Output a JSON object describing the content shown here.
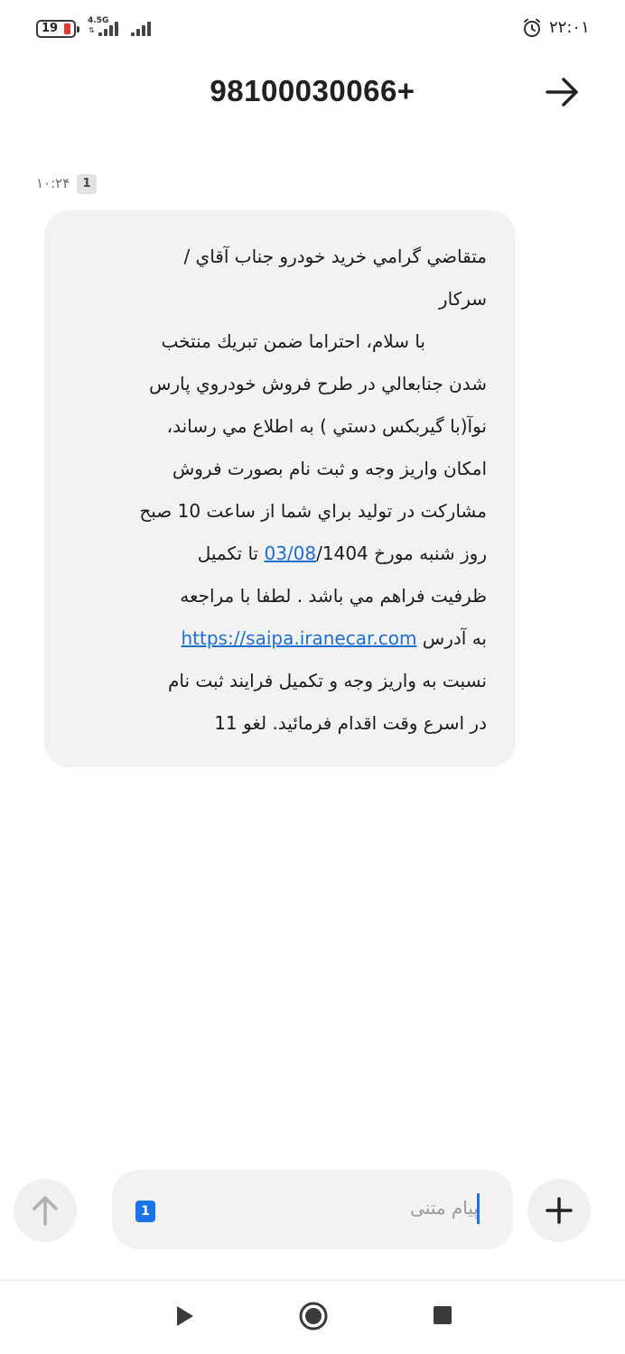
{
  "status_bar": {
    "battery_level": "19",
    "network_type": "4.5G",
    "clock": "۲۲:۰۱",
    "icons": [
      "battery-icon",
      "signal-icon",
      "signal-icon",
      "alarm-icon"
    ]
  },
  "header": {
    "title": "98100030066+",
    "back_icon": "arrow-right-icon"
  },
  "message": {
    "time": "۱۰:۲۴",
    "sim": "1",
    "lines": [
      "متقاضي گرامي خريد خودرو جناب آقاي /",
      "سركار",
      "با سلام، احتراما ضمن تبريك منتخب",
      "شدن جنابعالي در طرح فروش خودروي پارس",
      "نوآ(با گيربكس دستي ) به اطلاع مي رساند،",
      "امكان واريز وجه و ثبت نام بصورت فروش",
      "مشاركت در توليد براي شما از ساعت 10 صبح"
    ],
    "line8_prefix": "روز شنبه مورخ 1404/",
    "line8_date": "03/08",
    "line8_suffix": "  تا تكميل",
    "line9": "ظرفيت فراهم مي باشد . لطفا با مراجعه",
    "line10_prefix": "به آدرس ",
    "line10_link": "https://saipa.iranecar.com",
    "line11": "نسبت به واريز وجه و تكميل فرايند ثبت نام",
    "line12": "در اسرع وقت اقدام فرمائيد. لغو 11"
  },
  "compose": {
    "placeholder": "پیام متنی",
    "sim": "1"
  },
  "colors": {
    "accent": "#1a73e8",
    "link": "#1e6fd0",
    "bubble": "#f2f2f2",
    "battery_low": "#e53935"
  }
}
